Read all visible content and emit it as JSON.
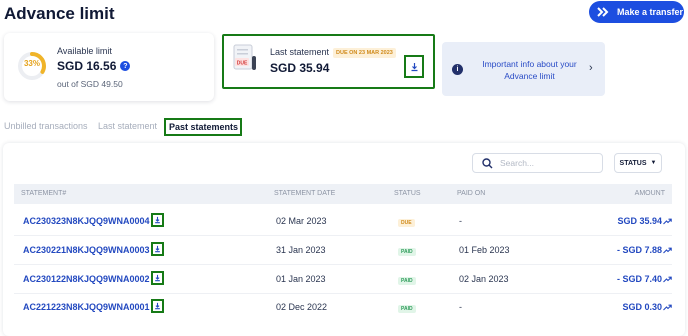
{
  "header": {
    "title": "Advance limit",
    "transfer_button": "Make a transfer"
  },
  "limit_card": {
    "percent": "33%",
    "percent_value": 33,
    "label": "Available limit",
    "value": "SGD 16.56",
    "out_of": "out of SGD 49.50"
  },
  "statement_card": {
    "label": "Last statement",
    "due_badge": "DUE ON 23 MAR 2023",
    "value": "SGD 35.94",
    "doc_badge": "DUE"
  },
  "info_card": {
    "text": "Important info about your Advance limit"
  },
  "tabs": [
    {
      "label": "Unbilled transactions",
      "active": false
    },
    {
      "label": "Last statement",
      "active": false
    },
    {
      "label": "Past statements",
      "active": true
    }
  ],
  "search": {
    "placeholder": "Search..."
  },
  "status_filter": {
    "label": "STATUS"
  },
  "table": {
    "headers": [
      "STATEMENT#",
      "STATEMENT DATE",
      "STATUS",
      "PAID ON",
      "AMOUNT"
    ],
    "rows": [
      {
        "id": "AC230323N8KJQQ9WNA0004",
        "date": "02 Mar 2023",
        "status": "DUE",
        "paid_on": "-",
        "amount": "SGD 35.94"
      },
      {
        "id": "AC230221N8KJQQ9WNA0003",
        "date": "31 Jan 2023",
        "status": "PAID",
        "paid_on": "01 Feb 2023",
        "amount": "- SGD 7.88"
      },
      {
        "id": "AC230122N8KJQQ9WNA0002",
        "date": "01 Jan 2023",
        "status": "PAID",
        "paid_on": "02 Jan 2023",
        "amount": "- SGD 7.40"
      },
      {
        "id": "AC221223N8KJQQ9WNA0001",
        "date": "02 Dec 2022",
        "status": "PAID",
        "paid_on": "-",
        "amount": "SGD 0.30"
      }
    ]
  },
  "colors": {
    "accent": "#1d4ee0",
    "link": "#2349c0",
    "ring": "#f0b429",
    "highlight": "#167a16"
  }
}
